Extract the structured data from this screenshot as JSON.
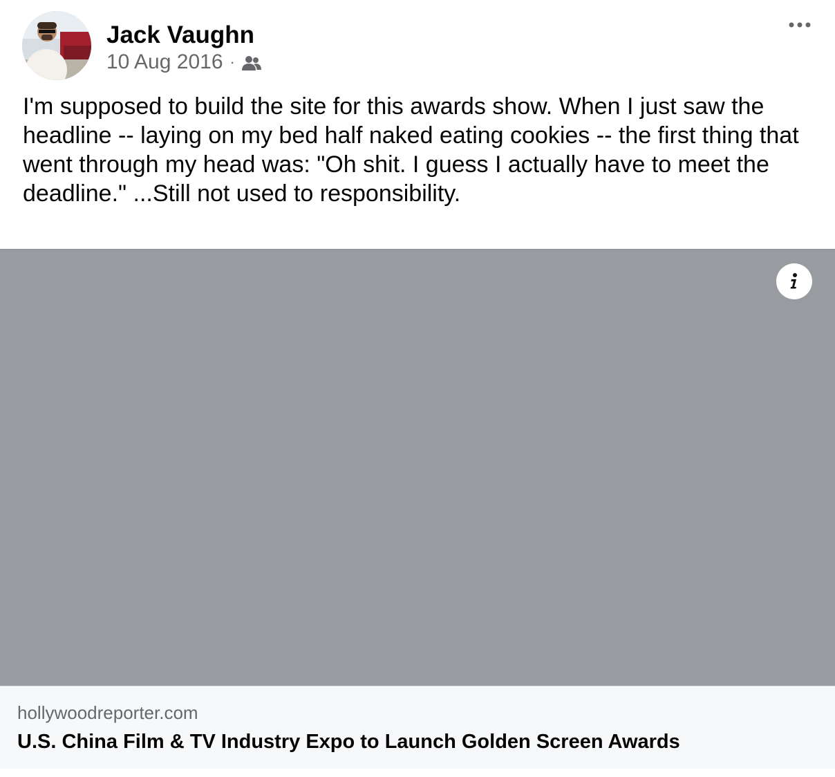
{
  "post": {
    "author": "Jack Vaughn",
    "date": "10 Aug 2016",
    "separator": "·",
    "audience_icon": "friends-icon",
    "more_icon": "more-options-icon",
    "text": "I'm supposed to build the site for this awards show. When I just saw the headline -- laying on my bed half naked eating cookies -- the first thing that went through my head was: \"Oh shit. I guess I actually have to meet the deadline.\" ...Still not used to responsibility."
  },
  "link_preview": {
    "domain": "hollywoodreporter.com",
    "title": "U.S. China Film & TV Industry Expo to Launch Golden Screen Awards",
    "image_placeholder_color": "#989b9f",
    "info_icon": "info-icon"
  },
  "colors": {
    "primary_text": "#050505",
    "secondary_text": "#65676b",
    "footer_background": "#f7f8fa"
  }
}
